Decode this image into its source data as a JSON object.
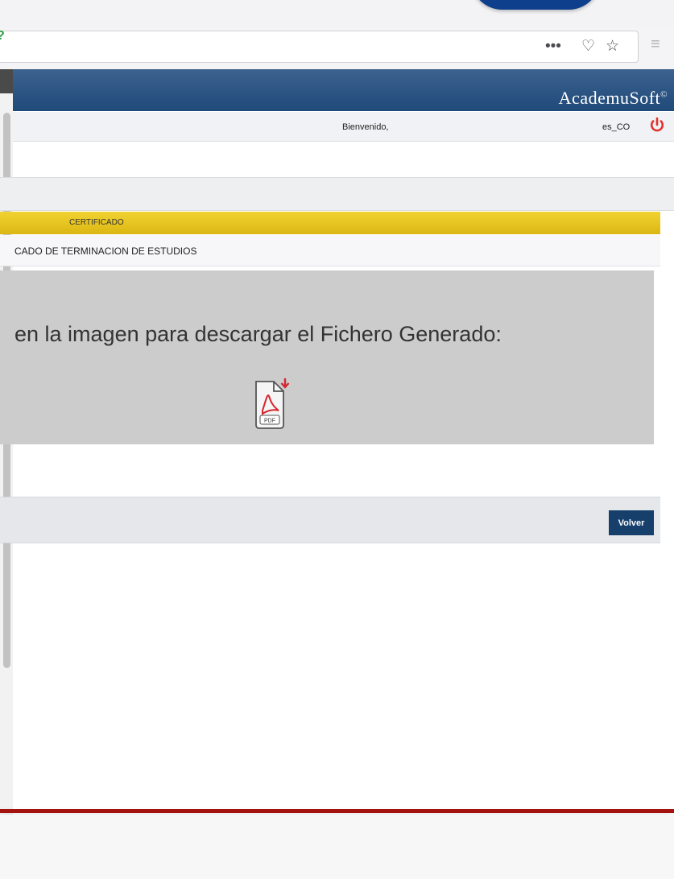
{
  "browser": {
    "toolbar_icons": [
      "more-icon",
      "pocket-icon",
      "bookmark-star-icon",
      "menu-icon"
    ],
    "more_glyph": "•••",
    "pocket_glyph": "♡",
    "star_glyph": "☆",
    "menu_glyph": "≡"
  },
  "header": {
    "brand": "AcademuSoft",
    "brand_mark": "©"
  },
  "userbar": {
    "welcome": "Bienvenido,",
    "locale": "es_CO",
    "logout_color": "#e3322b"
  },
  "section": {
    "label": "CERTIFICADO",
    "title": "CADO DE TERMINACION DE ESTUDIOS"
  },
  "download": {
    "message": "en la imagen para descargar el Fichero Generado:",
    "file_icon": "pdf-download-icon",
    "file_label": "PDF"
  },
  "actions": {
    "back_label": "Volver"
  },
  "colors": {
    "header": "#1f4a7a",
    "accent_yellow": "#f1d331",
    "button": "#163f6b",
    "footer_line": "#a31410"
  }
}
